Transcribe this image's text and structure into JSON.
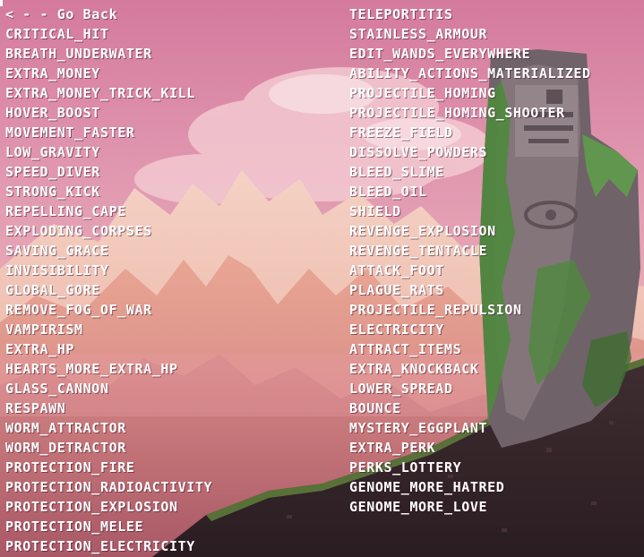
{
  "menu": {
    "back_label": "< - - Go Back",
    "left_items": [
      "CRITICAL_HIT",
      "BREATH_UNDERWATER",
      "EXTRA_MONEY",
      "EXTRA_MONEY_TRICK_KILL",
      "HOVER_BOOST",
      "MOVEMENT_FASTER",
      "LOW_GRAVITY",
      "SPEED_DIVER",
      "STRONG_KICK",
      "REPELLING_CAPE",
      "EXPLODING_CORPSES",
      "SAVING_GRACE",
      "INVISIBILITY",
      "GLOBAL_GORE",
      "REMOVE_FOG_OF_WAR",
      "VAMPIRISM",
      "EXTRA_HP",
      "HEARTS_MORE_EXTRA_HP",
      "GLASS_CANNON",
      "RESPAWN",
      "WORM_ATTRACTOR",
      "WORM_DETRACTOR",
      "PROTECTION_FIRE",
      "PROTECTION_RADIOACTIVITY",
      "PROTECTION_EXPLOSION",
      "PROTECTION_MELEE",
      "PROTECTION_ELECTRICITY"
    ],
    "right_items": [
      "TELEPORTITIS",
      "STAINLESS_ARMOUR",
      "EDIT_WANDS_EVERYWHERE",
      "ABILITY_ACTIONS_MATERIALIZED",
      "PROJECTILE_HOMING",
      "PROJECTILE_HOMING_SHOOTER",
      "FREEZE_FIELD",
      "DISSOLVE_POWDERS",
      "BLEED_SLIME",
      "BLEED_OIL",
      "SHIELD",
      "REVENGE_EXPLOSION",
      "REVENGE_TENTACLE",
      "ATTACK_FOOT",
      "PLAGUE_RATS",
      "PROJECTILE_REPULSION",
      "ELECTRICITY",
      "ATTRACT_ITEMS",
      "EXTRA_KNOCKBACK",
      "LOWER_SPREAD",
      "BOUNCE",
      "MYSTERY_EGGPLANT",
      "EXTRA_PERK",
      "PERKS_LOTTERY",
      "GENOME_MORE_HATRED",
      "GENOME_MORE_LOVE"
    ]
  },
  "colors": {
    "sky_top": "#d97fa0",
    "sky_mid": "#e3a0b6",
    "mountain_far": "#e8b6a8",
    "mountain_mid": "#dc8e84",
    "mountain_near": "#c8707a",
    "ground": "#3a2a2e",
    "pillar": "#7d6e74",
    "moss": "#4f8a3e",
    "text": "#ffffff"
  }
}
